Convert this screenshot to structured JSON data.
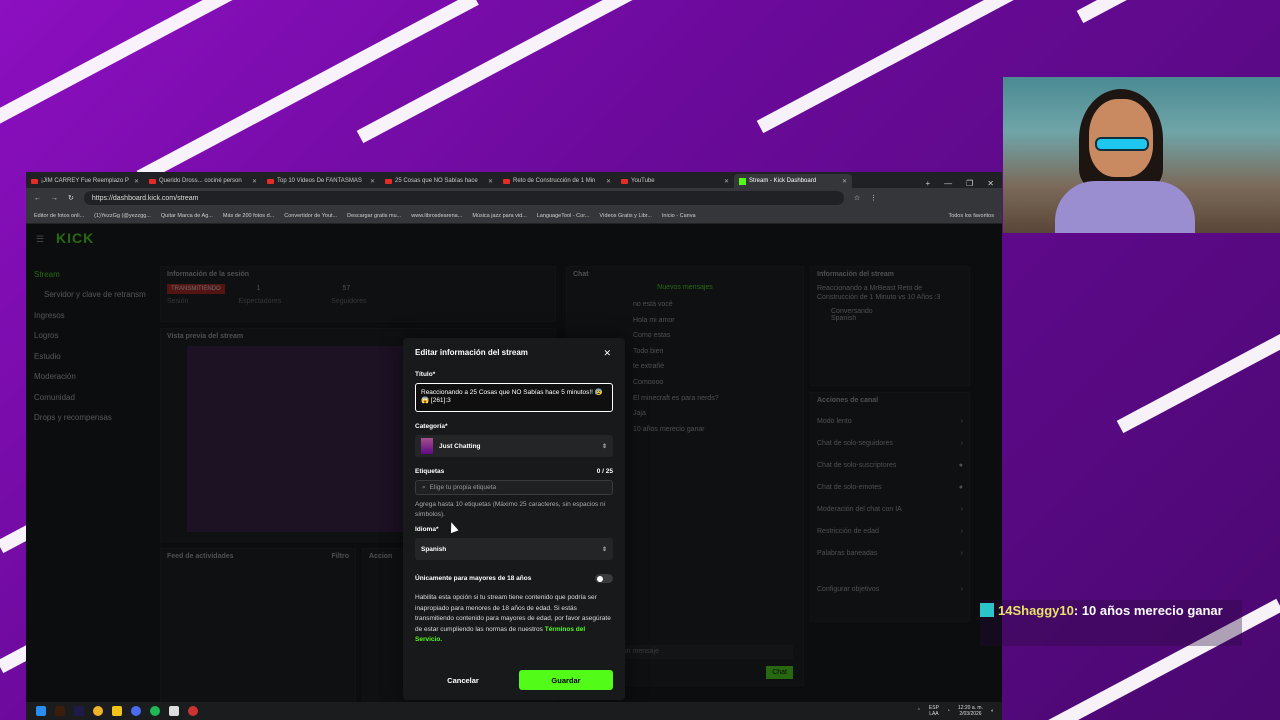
{
  "browser": {
    "tabs": [
      {
        "label": "¡JIM CARREY Fue Reemplazo P",
        "icon": "youtube-icon",
        "active": false
      },
      {
        "label": "Querido Dross... cociné person",
        "icon": "youtube-icon",
        "active": false
      },
      {
        "label": "Top 10 Videos De FANTASMAS",
        "icon": "youtube-icon",
        "active": false
      },
      {
        "label": "25 Cosas que NO Sabías hace",
        "icon": "youtube-icon",
        "active": false
      },
      {
        "label": "Reto de Construcción de 1 Min",
        "icon": "youtube-icon",
        "active": false
      },
      {
        "label": "YouTube",
        "icon": "youtube-icon",
        "active": false
      },
      {
        "label": "Stream - Kick Dashboard",
        "icon": "kick-icon",
        "active": true
      }
    ],
    "url": "https://dashboard.kick.com/stream",
    "bookmarks": [
      "Editor de fotos onli...",
      "(1)YezzGg (@yezzgg...",
      "Quitar Marca de Ag...",
      "Más de 200 fotos d...",
      "Convertidor de Yout...",
      "Descargar gratis mu...",
      "www.librosdearena...",
      "Música jazz para vid...",
      "LanguageTool - Cor...",
      "Vídeos Gratis y Libr...",
      "Inicio - Canva",
      "Todos los favoritos"
    ]
  },
  "dashboard": {
    "logo": "KICK",
    "sidebar": [
      "Stream",
      "Servidor y clave de retransm",
      "Ingresos",
      "Logros",
      "Estudio",
      "Moderación",
      "Comunidad",
      "Drops y recompensas"
    ],
    "session": {
      "title": "Información de la sesión",
      "status": "TRANSMITIENDO",
      "session_label": "Sesión",
      "viewers": "1",
      "viewers_label": "Espectadores",
      "followers": "57",
      "followers_label": "Seguidores"
    },
    "preview_title": "Vista previa del stream",
    "activity_title": "Feed de actividades",
    "activity_filter": "Filtro",
    "actions_short": "Accion",
    "chat": {
      "title": "Chat",
      "new_messages": "Nuevos mensajes",
      "messages": [
        "no está vocé",
        "Hola mi amor",
        "Como estas",
        "Todo bien",
        "te extrañé",
        "Comoooo",
        "El minecraft es para nerds?",
        "Jaja",
        "10 años merecio ganar"
      ],
      "input_placeholder": "Enviar un mensaje",
      "send": "Chat"
    },
    "stream_info": {
      "title": "Información del stream",
      "stream_title": "Reaccionando a MrBeast Reto de Construcción de 1 Minuto vs 10 Años :3",
      "category": "Conversando",
      "language": "Spanish"
    },
    "channel_actions": {
      "title": "Acciones de canal",
      "items": [
        "Modo lento",
        "Chat de solo-seguidores",
        "Chat de solo-suscriptores",
        "Chat de solo-emotes",
        "Moderación del chat con IA",
        "Restricción de edad",
        "Palabras baneadas",
        "Configurar objetivos"
      ]
    }
  },
  "modal": {
    "title": "Editar información del stream",
    "title_label": "Título*",
    "title_value": "Reaccionando a 25 Cosas que NO Sabías hace 5 minutos!! 😰😱 [261]:3",
    "category_label": "Categoría*",
    "category_value": "Just Chatting",
    "tags_label": "Etiquetas",
    "tags_count": "0 / 25",
    "tags_placeholder": "Elige tu propia etiqueta",
    "tags_hint": "Agrega hasta 10 etiquetas (Máximo 25 caracteres, sin espacios ni símbolos).",
    "language_label": "Idioma*",
    "language_value": "Spanish",
    "mature_label": "Únicamente para mayores de 18 años",
    "mature_text": "Habilita esta opción si tu stream tiene contenido que podría ser inapropiado para menores de 18 años de edad. Si estás transmitiendo contenido para mayores de edad, por favor asegúrate de estar cumpliendo las normas de nuestros",
    "terms_link": "Términos del Servicio.",
    "cancel": "Cancelar",
    "save": "Guardar"
  },
  "taskbar": {
    "lang": "ESP",
    "lang2": "LAA",
    "time": "12:20 a. m.",
    "date": "2/03/2026"
  },
  "overlay_chat": {
    "user": "14Shaggy10",
    "message": ": 10 años merecio ganar"
  },
  "colors": {
    "kick_green": "#53fc18",
    "live_red": "#c4221a",
    "background_purple": "#7a0aa8"
  }
}
